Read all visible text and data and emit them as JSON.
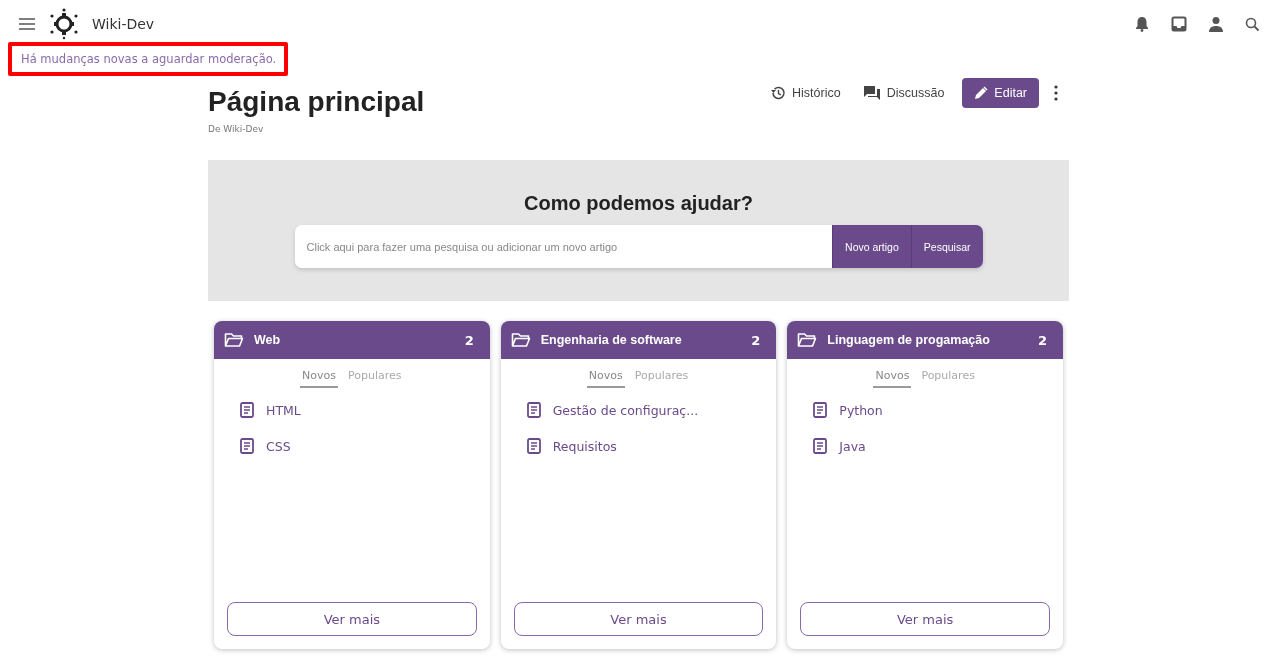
{
  "header": {
    "site_name": "Wiki-Dev"
  },
  "notice": {
    "text": "Há mudanças novas a aguardar moderação.",
    "highlighted": true
  },
  "page": {
    "title": "Página principal",
    "subtitle": "De Wiki-Dev"
  },
  "actions": [
    {
      "kind": "history",
      "label": "Histórico"
    },
    {
      "kind": "talk",
      "label": "Discussão"
    },
    {
      "kind": "edit",
      "label": "Editar"
    }
  ],
  "hero": {
    "title": "Como podemos ajudar?",
    "placeholder": "Click aqui para fazer uma pesquisa ou adicionar um novo artigo",
    "buttons": [
      "Novo artigo",
      "Pesquisar"
    ]
  },
  "categories": [
    {
      "name": "Web",
      "count": "2",
      "tabs": [
        {
          "label": "Novos",
          "selected": true
        },
        {
          "label": "Populares",
          "selected": false
        }
      ],
      "items": [
        "HTML",
        "CSS"
      ],
      "more": "Ver mais"
    },
    {
      "name": "Engenharia de software",
      "count": "2",
      "tabs": [
        {
          "label": "Novos",
          "selected": true
        },
        {
          "label": "Populares",
          "selected": false
        }
      ],
      "items": [
        "Gestão de configuraç...",
        "Requisitos"
      ],
      "more": "Ver mais"
    },
    {
      "name": "Linguagem de progamação",
      "count": "2",
      "tabs": [
        {
          "label": "Novos",
          "selected": true
        },
        {
          "label": "Populares",
          "selected": false
        }
      ],
      "items": [
        "Python",
        "Java"
      ],
      "more": "Ver mais"
    }
  ]
}
